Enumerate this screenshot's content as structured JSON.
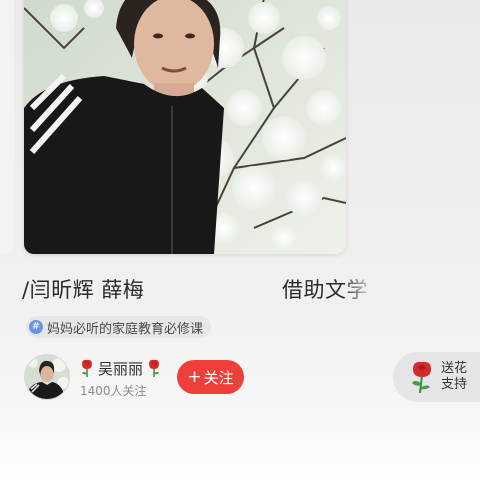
{
  "cover": {
    "alt": "cover-photo"
  },
  "article": {
    "title_part1": "/闫昕辉  薛梅",
    "title_part2": "借助文学"
  },
  "tag": {
    "icon_glyph": "#",
    "label": "妈妈必听的家庭教育必修课"
  },
  "author": {
    "name": "吴丽丽",
    "followers": "1400人关注"
  },
  "actions": {
    "follow_plus": "+",
    "follow_label": "关注",
    "gift_line1": "送花",
    "gift_line2": "支持"
  },
  "colors": {
    "accent_red": "#ef3f3b",
    "tag_blue": "#6a92e6"
  }
}
